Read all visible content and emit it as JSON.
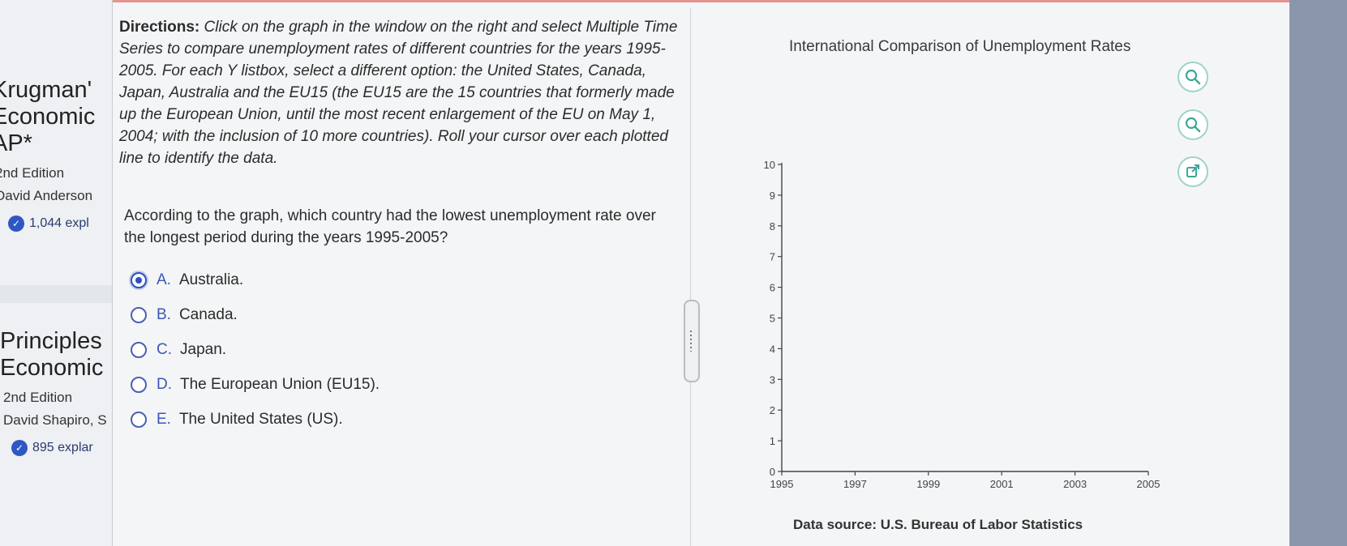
{
  "sidebar": {
    "books": [
      {
        "title_lines": [
          "Krugman'",
          "Economic",
          "AP*"
        ],
        "edition": "2nd Edition",
        "author": "David Anderson",
        "explanations": "1,044 expl"
      },
      {
        "title_lines": [
          "Principles",
          "Economic"
        ],
        "edition": "2nd Edition",
        "author": "David Shapiro, S",
        "explanations": "895 explar"
      }
    ]
  },
  "question": {
    "directions_lead": "Directions:",
    "directions_body": "Click on the graph in the window on the right and select Multiple Time Series to compare unemployment rates of different countries for the years 1995-2005. For each Y listbox, select a different option: the United States, Canada, Japan, Australia and the EU15 (the EU15 are the 15 countries that formerly made up the European Union, until the most recent enlargement of the EU on May 1, 2004; with the inclusion of 10 more countries). Roll your cursor over each plotted line to identify the data.",
    "prompt": "According to the graph, which country had the lowest unemployment rate over the longest period during the years 1995-2005?",
    "choices": [
      {
        "letter": "A.",
        "text": "Australia.",
        "selected": true
      },
      {
        "letter": "B.",
        "text": "Canada.",
        "selected": false
      },
      {
        "letter": "C.",
        "text": "Japan.",
        "selected": false
      },
      {
        "letter": "D.",
        "text": "The European Union (EU15).",
        "selected": false
      },
      {
        "letter": "E.",
        "text": "The United States (US).",
        "selected": false
      }
    ]
  },
  "graph": {
    "title": "International Comparison of Unemployment Rates",
    "data_source_label": "Data source:",
    "data_source_value": "U.S. Bureau of Labor Statistics",
    "tools": [
      "zoom-in-icon",
      "zoom-out-icon",
      "open-external-icon"
    ]
  },
  "chart_data": {
    "type": "line",
    "title": "International Comparison of Unemployment Rates",
    "xlabel": "",
    "ylabel": "",
    "xlim": [
      1995,
      2005
    ],
    "ylim": [
      0,
      10
    ],
    "x_ticks": [
      "1995",
      "1997",
      "1999",
      "2001",
      "2003",
      "2005"
    ],
    "y_ticks": [
      "0",
      "1",
      "2",
      "3",
      "4",
      "5",
      "6",
      "7",
      "8",
      "9",
      "10"
    ],
    "series": [],
    "grid": false
  }
}
